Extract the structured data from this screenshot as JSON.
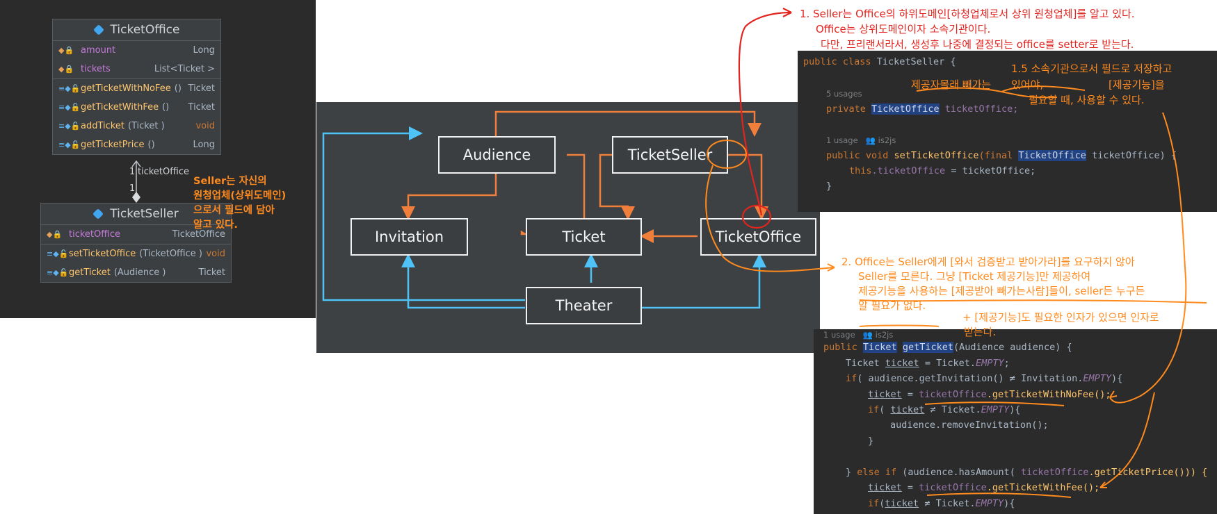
{
  "uml": {
    "ticket_office": {
      "title": "TicketOffice",
      "fields": [
        {
          "name": "amount",
          "type": "Long"
        },
        {
          "name": "tickets",
          "type": "List<Ticket >"
        }
      ],
      "methods": [
        {
          "name": "getTicketWithNoFee",
          "params": "()",
          "type": "Ticket"
        },
        {
          "name": "getTicketWithFee",
          "params": "()",
          "type": "Ticket"
        },
        {
          "name": "addTicket",
          "params": "(Ticket )",
          "type": "void"
        },
        {
          "name": "getTicketPrice",
          "params": "()",
          "type": "Long"
        }
      ]
    },
    "ticket_seller": {
      "title": "TicketSeller",
      "fields": [
        {
          "name": "ticketOffice",
          "type": "TicketOffice"
        }
      ],
      "methods": [
        {
          "name": "setTicketOffice",
          "params": "(TicketOffice )",
          "type": "void"
        },
        {
          "name": "getTicket",
          "params": "(Audience )",
          "type": "Ticket"
        }
      ]
    },
    "association": {
      "mult_top": "1",
      "role": "ticketOffice",
      "mult_bottom": "1"
    },
    "seller_note": [
      "Seller는 자신의",
      "원청업체(상위도메인)",
      "으로서 필드에 담아",
      "알고 있다."
    ]
  },
  "dependency": {
    "boxes": {
      "audience": "Audience",
      "ticket_seller": "TicketSeller",
      "invitation": "Invitation",
      "ticket": "Ticket",
      "ticket_office": "TicketOffice",
      "theater": "Theater"
    }
  },
  "notes": {
    "note1": [
      "1. Seller는 Office의 하위도메인[하청업체로서 상위 원청업체]를 알고 있다.",
      "Office는 상위도메인이자 소속기관이다.",
      "다만, 프리랜서라서, 생성후 나중에 결정되는 office를 setter로 받는다."
    ],
    "note15": [
      "1.5 소속기관으로서 필드로 저장하고",
      "있어야,",
      "[제공기능]을",
      "필요할 때, 사용할 수 있다."
    ],
    "sneak": "제공자몰래 빼가는",
    "note2": [
      "2. Office는 Seller에게 [와서 검증받고 받아가라]를 요구하지 않아",
      "Seller를 모른다. 그냥 [Ticket 제공기능]만 제공하여",
      "제공기능을 사용하는 [제공받아 빼가는사람]들이, seller든 누구든",
      "알 필요가 없다."
    ],
    "note_plus": [
      "+ [제공기능]도 필요한 인자가 있으면 인자로",
      "받는다."
    ]
  },
  "code_top": {
    "class_kw": "public class",
    "class_name": "TicketSeller",
    "brace": "{",
    "usages1": "5 usages",
    "field_mod": "private",
    "field_type": "TicketOffice",
    "field_name": "ticketOffice;",
    "usages2": "1 usage",
    "author": "is2js",
    "m_mods": "public void",
    "m_name": "setTicketOffice",
    "m_open": "(final",
    "m_ptype": "TicketOffice",
    "m_pname": "ticketOffice) {",
    "body_this": "this",
    "body_field": ".ticketOffice",
    "body_rest": " = ticketOffice;",
    "close": "}"
  },
  "code_bottom": {
    "usage": "1 usage",
    "author": "is2js",
    "lines": {
      "l1_kw": "public",
      "l1_type": "Ticket",
      "l1_name": "getTicket",
      "l1_rest": "(Audience audience) {",
      "l2_type": "Ticket",
      "l2_var": "ticket",
      "l2_mid": " = ",
      "l2_cls": "Ticket.",
      "l2_const": "EMPTY",
      "l2_end": ";",
      "l3_kw": "if",
      "l3_rest": "( audience.getInvitation() ≠ Invitation.",
      "l3_const": "EMPTY",
      "l3_end": "){",
      "l4_var": "ticket",
      "l4_mid": " = ",
      "l4_field": "ticketOffice",
      "l4_call": ".getTicketWithNoFee();",
      "l5_kw": "if",
      "l5_open": "( ",
      "l5_var": "ticket",
      "l5_ne": " ≠ ",
      "l5_cls": "Ticket.",
      "l5_const": "EMPTY",
      "l5_end": "){",
      "l6": "audience.removeInvitation();",
      "l7": "}",
      "l8_close": "} ",
      "l8_kw": "else if",
      "l8_rest": " (audience.hasAmount( ",
      "l8_field": "ticketOffice",
      "l8_call": ".getTicketPrice())) {",
      "l9_var": "ticket",
      "l9_mid": " = ",
      "l9_field": "ticketOffice",
      "l9_call": ".getTicketWithFee();",
      "l10_kw": "if",
      "l10_open": "(",
      "l10_var": "ticket",
      "l10_ne": " ≠ ",
      "l10_cls": "Ticket.",
      "l10_const": "EMPTY",
      "l10_end": "){"
    }
  },
  "colors": {
    "accent_orange": "#ff8a1e",
    "note_red": "#e2241f",
    "arrow_blue": "#4fc3f7",
    "arrow_orange": "#f07f3c"
  }
}
